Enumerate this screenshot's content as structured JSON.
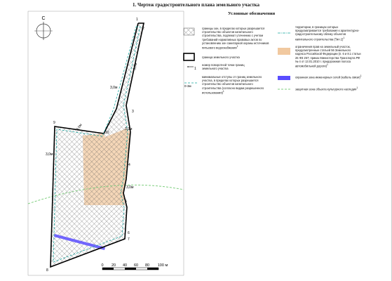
{
  "title": "1. Чертеж градостроительного плана земельного участка",
  "north_letter": "С",
  "legend": {
    "heading": "Условные обозначения",
    "left": [
      {
        "text": "границы зон, в пределах которых разрешается строительство объектов капитального строительства, подлежат уточнению с учетом требований нормативных правовых актов по установлению зон санитарной охраны источников питьевого водоснабжения",
        "sup": "1"
      },
      {
        "text": "граница земельного участка",
        "sup": ""
      },
      {
        "text": "номер поворотной точки границ земельного участка",
        "sup": ""
      },
      {
        "text": "минимальные отступы от границ земельного участка, в пределах которых разрешается строительство объектов капитального строительства (согласно видам разрешенного использования)",
        "sup": "1"
      }
    ],
    "right": [
      {
        "text": "территории, в границах которых предусматривается требования к архитектурно-градостроительному облику объектов капитального строительства (Тип 2)",
        "sup": "1"
      },
      {
        "text": "ограничения прав на земельный участок, предусмотренные статьей 56 Земельного кодекса Российской Федерации (п. 6 и 8.1 статьи 26 ФЗ 257; приказ Министерства Транспорта РФ № 4 от 13.01.2010 г. придорожная полоса автомобильной дороги)",
        "sup": "1"
      },
      {
        "text": "охранная зона инженерных сетей (кабель связи)",
        "sup": "1"
      },
      {
        "text": "защитная зона объекта культурного наследия",
        "sup": "1"
      }
    ],
    "symbols": {
      "point_number": "1",
      "setback": "0-3м"
    }
  },
  "map": {
    "points": [
      "1",
      "2",
      "3",
      "4",
      "5",
      "6",
      "7",
      "8",
      "9",
      "10"
    ],
    "setbacks": [
      "3,0м",
      "3,0м",
      "3,0м",
      "3,0м",
      "3,0м",
      "3,0м"
    ],
    "scale_ticks": [
      "0",
      "20",
      "40",
      "60",
      "80",
      "100 м"
    ]
  },
  "colors": {
    "boundary": "#000000",
    "setback": "#1aa7a0",
    "road_zone": "#f1c9a0",
    "cable_zone": "#5a4dff",
    "heritage_zone": "#7fcf7f"
  }
}
